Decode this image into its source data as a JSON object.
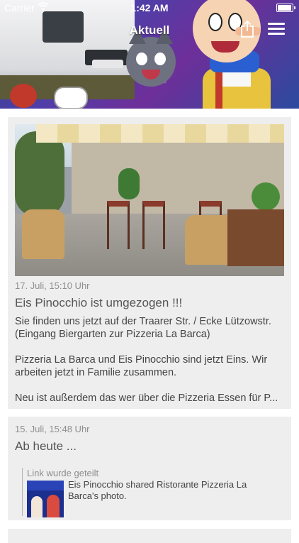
{
  "status_bar": {
    "carrier": "Carrier",
    "time": "1:42 AM"
  },
  "nav": {
    "title": "Aktuell"
  },
  "posts": [
    {
      "date": "17. Juli, 15:10 Uhr",
      "title": "Eis Pinocchio ist umgezogen !!!",
      "paragraphs": [
        [
          "Sie finden uns jetzt auf der Traarer Str. / Ecke Lützowstr.",
          "(Eingang Biergarten zur Pizzeria La Barca)"
        ],
        [
          "Pizzeria La Barca und Eis Pinocchio sind jetzt Eins. Wir",
          "arbeiten jetzt in Familie zusammen."
        ],
        [
          "Neu ist außerdem das wer über die Pizzeria Essen für P..."
        ]
      ]
    },
    {
      "date": "15. Juli, 15:48 Uhr",
      "title": "Ab heute ...",
      "link": {
        "label": "Link wurde geteilt",
        "text": "Eis Pinocchio shared Ristorante Pizzeria La Barca's photo."
      }
    }
  ]
}
